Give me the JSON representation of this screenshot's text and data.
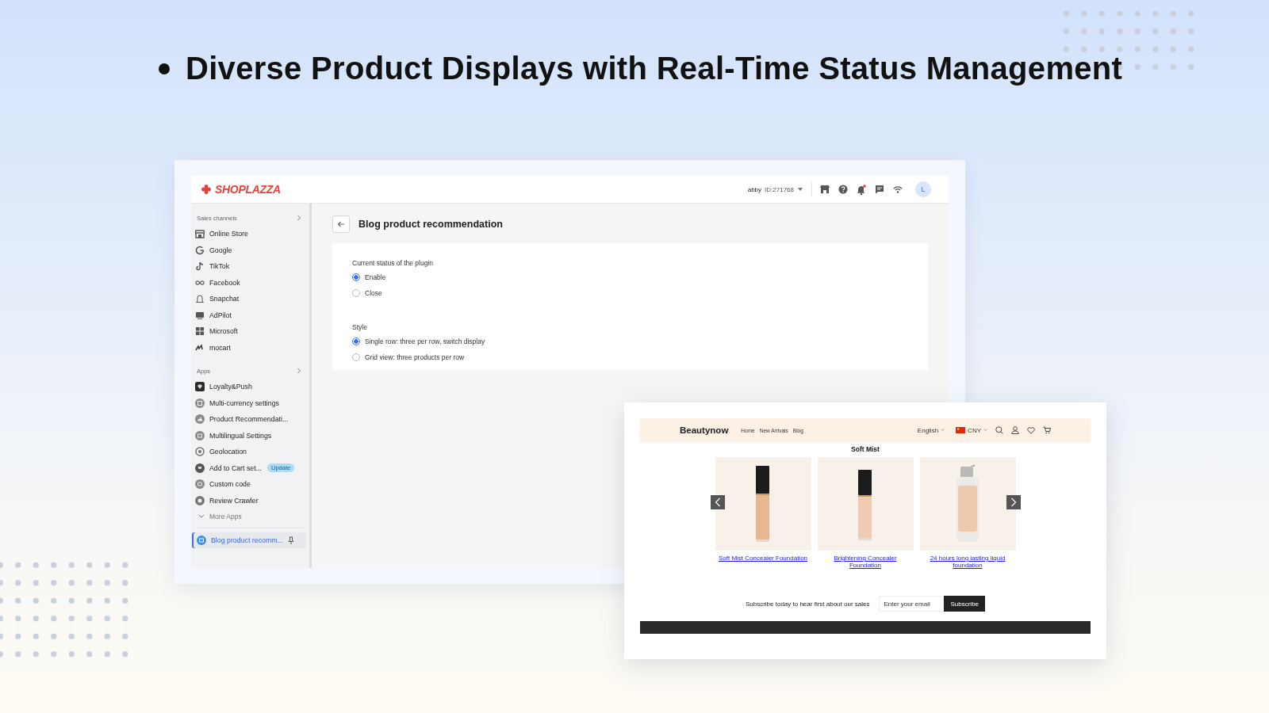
{
  "heading": "Diverse Product Displays with Real-Time Status Management",
  "admin": {
    "logo": "SHOPLAZZA",
    "account": {
      "name": "abby",
      "id": "ID:271768"
    },
    "avatar": "L",
    "sidebar": {
      "sections": [
        {
          "title": "Sales channels",
          "items": [
            {
              "label": "Online Store"
            },
            {
              "label": "Google"
            },
            {
              "label": "TikTok"
            },
            {
              "label": "Facebook"
            },
            {
              "label": "Snapchat"
            },
            {
              "label": "AdPilot"
            },
            {
              "label": "Microsoft"
            },
            {
              "label": "mocart"
            }
          ]
        },
        {
          "title": "Apps",
          "items": [
            {
              "label": "Loyalty&Push"
            },
            {
              "label": "Multi-currency settings"
            },
            {
              "label": "Product Recommendati..."
            },
            {
              "label": "Multilingual Settings"
            },
            {
              "label": "Geolocation"
            },
            {
              "label": "Add to Cart set...",
              "badge": "Update"
            },
            {
              "label": "Custom code"
            },
            {
              "label": "Review Crawler"
            }
          ]
        }
      ],
      "more": "More Apps",
      "pinned": {
        "label": "Blog product recomm...",
        "selected": true
      }
    },
    "page": {
      "title": "Blog product recommendation",
      "groups": [
        {
          "label": "Current status of the plugin",
          "options": [
            {
              "label": "Enable",
              "selected": true
            },
            {
              "label": "Close",
              "selected": false
            }
          ]
        },
        {
          "label": "Style",
          "options": [
            {
              "label": "Single row: three per row, switch display",
              "selected": true
            },
            {
              "label": "Grid view: three products per row",
              "selected": false
            }
          ]
        }
      ]
    }
  },
  "storefront": {
    "brand": "Beautynow",
    "nav": [
      "Home",
      "New Arrivals",
      "Blog"
    ],
    "language": "English",
    "currency": "CNY",
    "section_title": "Soft Mist",
    "products": [
      {
        "name": "Soft Mist Concealer Foundation",
        "kind": "picture"
      },
      {
        "name": "Brightening Concealer Foundation",
        "kind": "picture"
      },
      {
        "name": "24 hours long lasting liquid foundation",
        "kind": "picture"
      }
    ],
    "subscribe": {
      "text": "Subscribe today to hear first about our sales",
      "placeholder": "Enter your email",
      "button": "Subscribe"
    }
  }
}
